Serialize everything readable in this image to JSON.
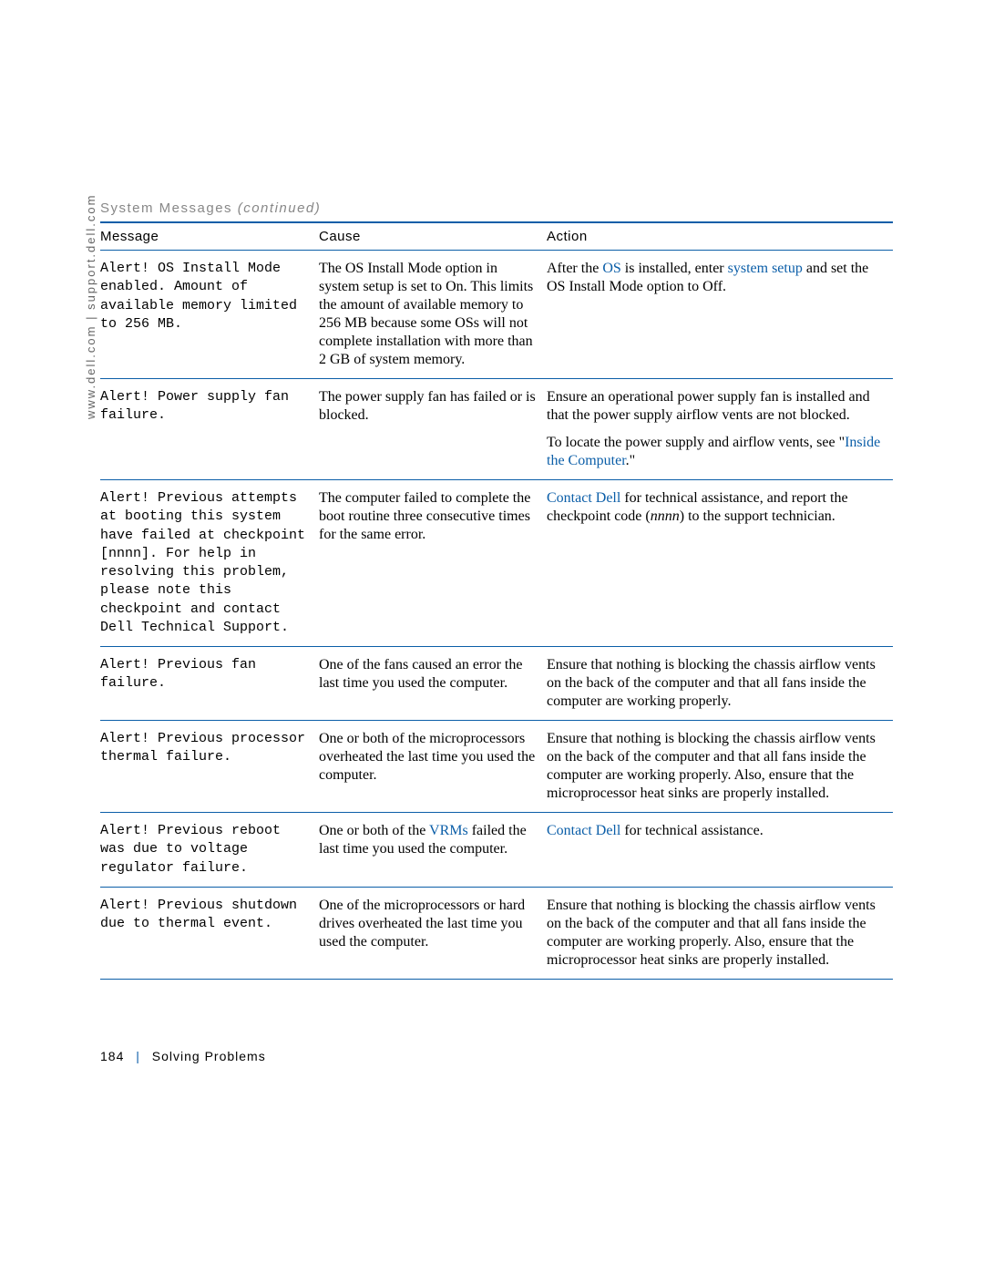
{
  "side_url": "www.dell.com | support.dell.com",
  "table_title": "System Messages ",
  "table_title_cont": "(continued)",
  "headers": {
    "message": "Message",
    "cause": "Cause",
    "action": "Action"
  },
  "rows": [
    {
      "message": "Alert! OS Install Mode enabled. Amount of available memory limited to 256 MB.",
      "cause": "The OS Install Mode option in system setup is set to On. This limits the amount of available memory to 256 MB because some OSs will not complete installation with more than 2 GB of system memory.",
      "action_pre": "After the ",
      "action_link1": "OS",
      "action_mid1": " is installed, enter ",
      "action_link2": "system setup",
      "action_post": " and set the OS Install Mode option to Off."
    },
    {
      "message": "Alert! Power supply fan failure.",
      "cause": "The power supply fan has failed or is blocked.",
      "action1": "Ensure an operational power supply fan is installed and that the power supply airflow vents are not blocked.",
      "action2_pre": "To locate the power supply and airflow vents, see \"",
      "action2_link": "Inside the Computer",
      "action2_post": ".\""
    },
    {
      "message": "Alert! Previous attempts at booting this system have failed at checkpoint [nnnn]. For help in resolving this problem, please note this checkpoint and contact Dell Technical Support.",
      "cause": "The computer failed to complete the boot routine three consecutive times for the same error.",
      "action_link": "Contact Dell",
      "action_mid": " for technical assistance, and report the checkpoint code (",
      "action_ital": "nnnn",
      "action_post": ") to the support technician."
    },
    {
      "message": "Alert! Previous fan failure.",
      "cause": "One of the fans caused an error the last time you used the computer.",
      "action": "Ensure that nothing is blocking the chassis airflow vents on the back of the computer and that all fans inside the computer are working properly."
    },
    {
      "message": "Alert! Previous processor thermal failure.",
      "cause": "One or both of the microprocessors overheated the last time you used the computer.",
      "action": "Ensure that nothing is blocking the chassis airflow vents on the back of the computer and that all fans inside the computer are working properly. Also, ensure that the microprocessor heat sinks are properly installed."
    },
    {
      "message": "Alert! Previous reboot was due to voltage regulator failure.",
      "cause_pre": "One or both of the ",
      "cause_link": "VRMs",
      "cause_post": " failed the last time you used the computer.",
      "action_link": "Contact Dell",
      "action_post": " for technical assistance."
    },
    {
      "message": "Alert! Previous shutdown due to thermal event.",
      "cause": "One of the microprocessors or hard drives overheated the last time you used the computer.",
      "action": "Ensure that nothing is blocking the chassis airflow vents on the back of the computer and that all fans inside the computer are working properly. Also, ensure that the microprocessor heat sinks are properly installed."
    }
  ],
  "footer": {
    "page": "184",
    "section": "Solving Problems"
  }
}
